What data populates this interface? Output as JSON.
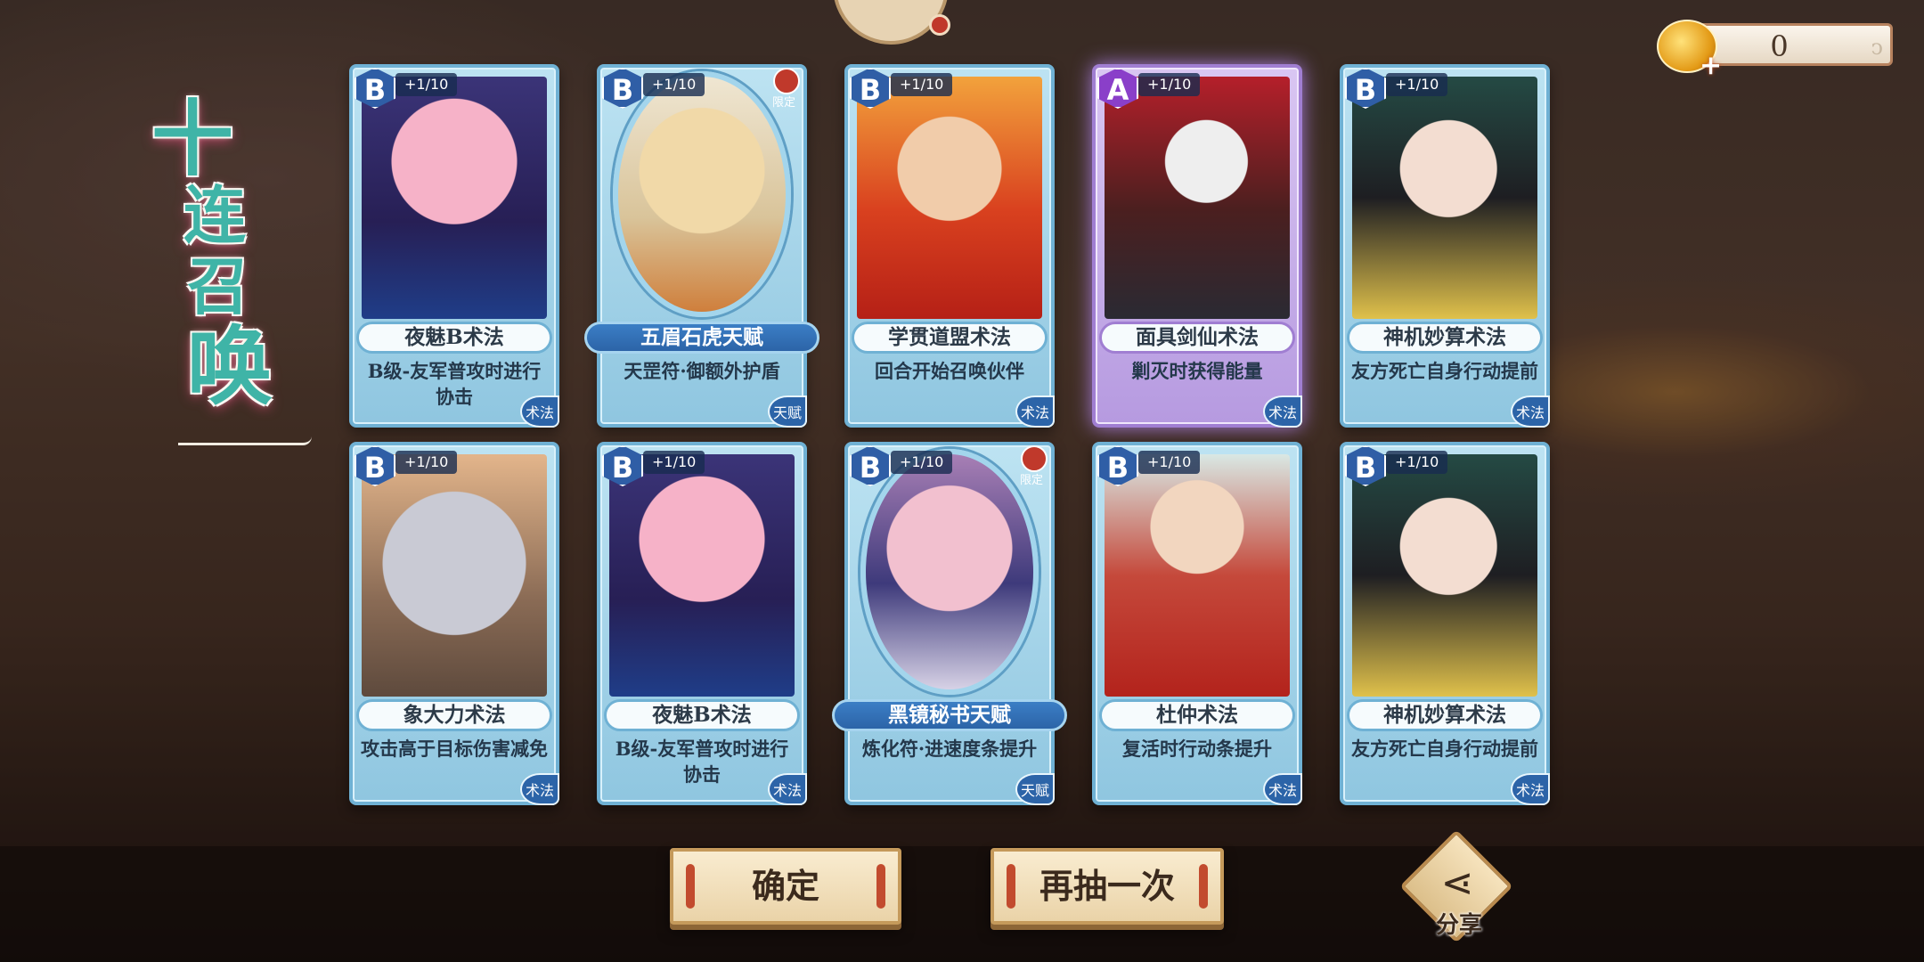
{
  "title": [
    "十",
    "连",
    "召",
    "唤"
  ],
  "currency": {
    "value": "0",
    "icon": "gold-ingot-icon",
    "plus": "+"
  },
  "cards": [
    {
      "rarity": "B",
      "count": "+1/10",
      "name": "夜魅B术法",
      "desc": "B级-友军普攻时进行协击",
      "type": "术法",
      "limited": "",
      "talent": false,
      "portrait": "p1"
    },
    {
      "rarity": "B",
      "count": "+1/10",
      "name": "五眉石虎天赋",
      "desc": "天罡符·御额外护盾",
      "type": "天赋",
      "limited": "限定",
      "talent": true,
      "portrait": "p2"
    },
    {
      "rarity": "B",
      "count": "+1/10",
      "name": "学贯道盟术法",
      "desc": "回合开始召唤伙伴",
      "type": "术法",
      "limited": "",
      "talent": false,
      "portrait": "p3"
    },
    {
      "rarity": "A",
      "count": "+1/10",
      "name": "面具剑仙术法",
      "desc": "剿灭时获得能量",
      "type": "术法",
      "limited": "",
      "talent": false,
      "portrait": "p4"
    },
    {
      "rarity": "B",
      "count": "+1/10",
      "name": "神机妙算术法",
      "desc": "友方死亡自身行动提前",
      "type": "术法",
      "limited": "",
      "talent": false,
      "portrait": "p5"
    },
    {
      "rarity": "B",
      "count": "+1/10",
      "name": "象大力术法",
      "desc": "攻击高于目标伤害减免",
      "type": "术法",
      "limited": "",
      "talent": false,
      "portrait": "p6"
    },
    {
      "rarity": "B",
      "count": "+1/10",
      "name": "夜魅B术法",
      "desc": "B级-友军普攻时进行协击",
      "type": "术法",
      "limited": "",
      "talent": false,
      "portrait": "p1"
    },
    {
      "rarity": "B",
      "count": "+1/10",
      "name": "黑镜秘书天赋",
      "desc": "炼化符·进速度条提升",
      "type": "天赋",
      "limited": "限定",
      "talent": true,
      "portrait": "p7"
    },
    {
      "rarity": "B",
      "count": "+1/10",
      "name": "杜仲术法",
      "desc": "复活时行动条提升",
      "type": "术法",
      "limited": "",
      "talent": false,
      "portrait": "p8"
    },
    {
      "rarity": "B",
      "count": "+1/10",
      "name": "神机妙算术法",
      "desc": "友方死亡自身行动提前",
      "type": "术法",
      "limited": "",
      "talent": false,
      "portrait": "p5"
    }
  ],
  "buttons": {
    "confirm": "确定",
    "redraw": "再抽一次",
    "share": "分享"
  },
  "colors": {
    "accent_teal": "#3fb4a7",
    "card_blue": "#8fc6e0",
    "card_purple": "#b69ae0",
    "button_cream": "#f9ecd0"
  }
}
